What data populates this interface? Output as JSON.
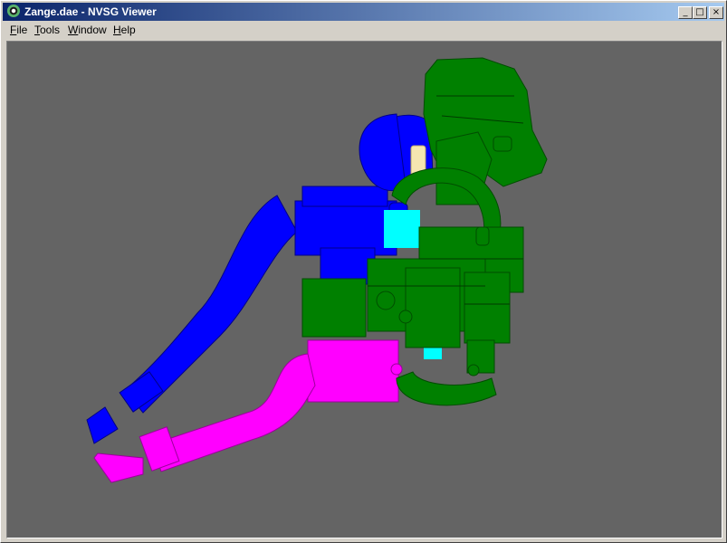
{
  "window": {
    "title": "Zange.dae - NVSG Viewer",
    "controls": {
      "minimize": "_",
      "maximize": "□",
      "close": "×"
    }
  },
  "menu": {
    "file": {
      "accel": "F",
      "rest": "ile"
    },
    "tools": {
      "accel": "T",
      "rest": "ools"
    },
    "window": {
      "accel": "W",
      "rest": "indow"
    },
    "help": {
      "accel": "H",
      "rest": "elp"
    }
  },
  "viewport": {
    "background": "#646464",
    "model_parts": [
      {
        "name": "green-assembly",
        "color": "#008000"
      },
      {
        "name": "blue-arm",
        "color": "#0000ff"
      },
      {
        "name": "magenta-arm",
        "color": "#ff00ff"
      },
      {
        "name": "cyan-part",
        "color": "#00ffff"
      },
      {
        "name": "cream-part",
        "color": "#f5e6b0"
      }
    ]
  }
}
